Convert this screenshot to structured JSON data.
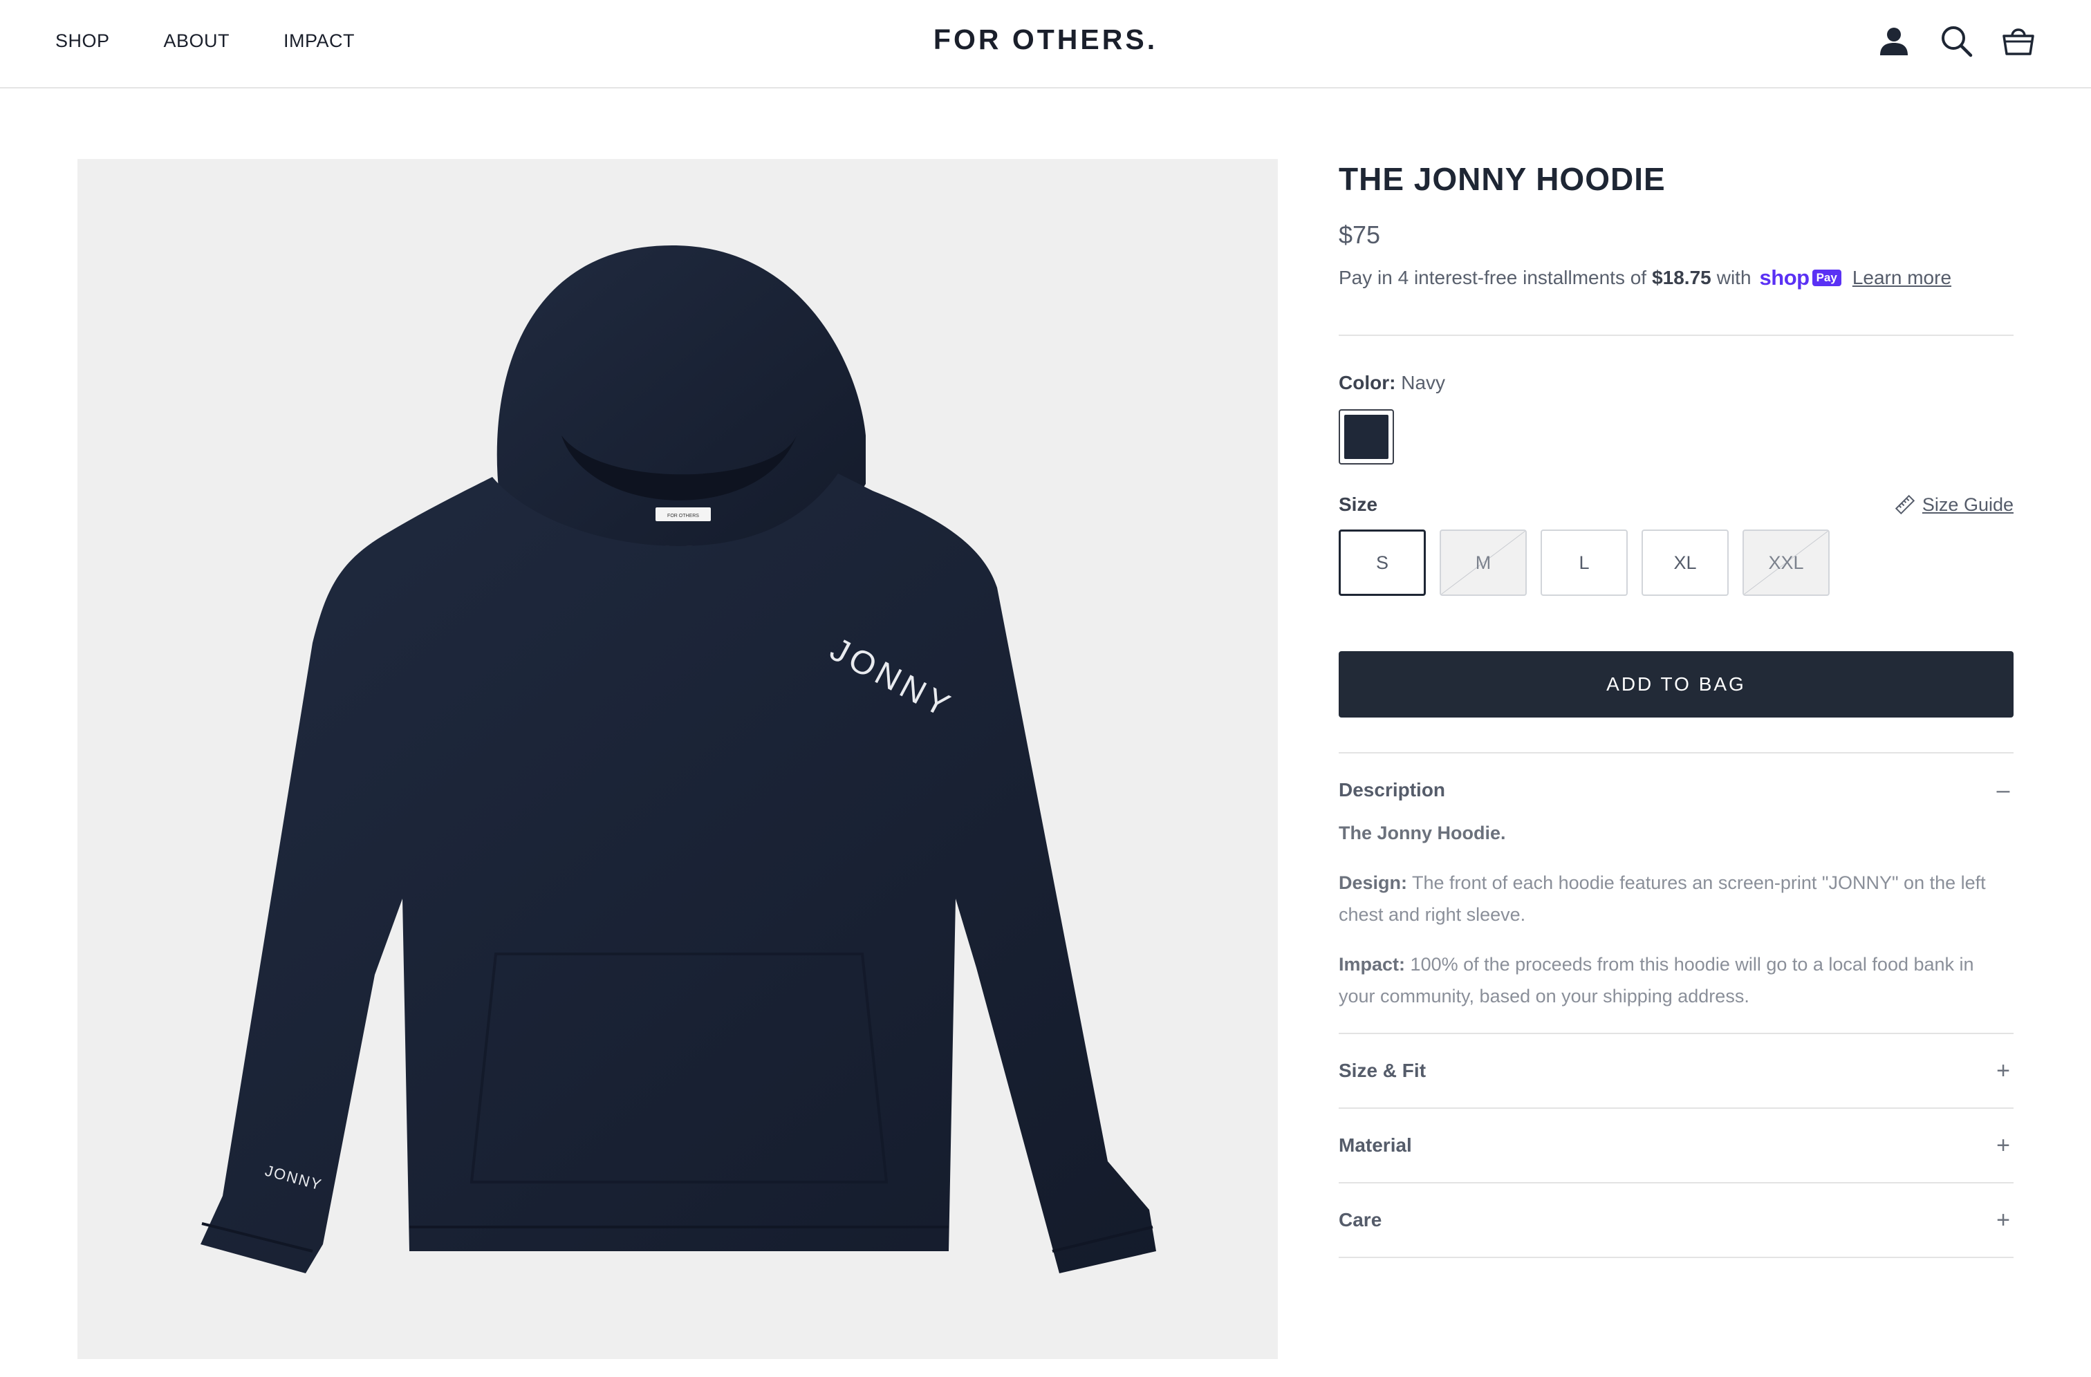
{
  "header": {
    "nav": [
      "SHOP",
      "ABOUT",
      "IMPACT"
    ],
    "logo": "FOR OTHERS."
  },
  "icons": {
    "account": "user-icon",
    "search": "search-icon",
    "bag": "bag-icon"
  },
  "product": {
    "title": "THE JONNY HOODIE",
    "price": "$75",
    "installments": {
      "prefix": "Pay in 4 interest-free installments of",
      "amount": "$18.75",
      "suffix": "with",
      "brand": "shop",
      "badge": "Pay",
      "link": "Learn more"
    },
    "image": {
      "chest_print": "JONNY",
      "sleeve_print": "JONNY",
      "neck_label": "FOR OTHERS"
    },
    "color": {
      "label": "Color:",
      "value": "Navy",
      "swatch": "#1f2838"
    },
    "size": {
      "label": "Size",
      "guide": "Size Guide",
      "options": [
        {
          "label": "S",
          "state": "selected"
        },
        {
          "label": "M",
          "state": "soldout"
        },
        {
          "label": "L",
          "state": "available"
        },
        {
          "label": "XL",
          "state": "available"
        },
        {
          "label": "XXL",
          "state": "soldout"
        }
      ]
    },
    "add_to_bag": "ADD TO BAG",
    "accordion": {
      "description": {
        "title": "Description",
        "icon": "–",
        "intro": "The Jonny Hoodie.",
        "design_label": "Design:",
        "design_text": "The front of each hoodie features an screen-print \"JONNY\" on the left chest and right sleeve.",
        "impact_label": "Impact:",
        "impact_text": "100% of the proceeds from this hoodie will go to a local food bank in your community, based on your shipping address."
      },
      "sections": [
        {
          "title": "Size & Fit",
          "icon": "+"
        },
        {
          "title": "Material",
          "icon": "+"
        },
        {
          "title": "Care",
          "icon": "+"
        }
      ]
    }
  },
  "colors": {
    "brand_dark": "#222a37",
    "hoodie": "#1c2437",
    "shop_pay": "#5a31f4"
  }
}
